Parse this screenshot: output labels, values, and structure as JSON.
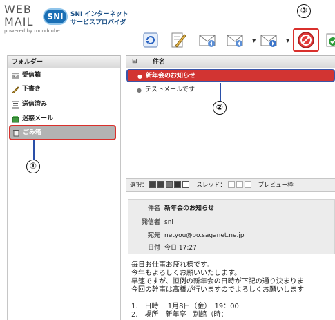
{
  "logo": {
    "web": "WEB",
    "mail": "MAIL",
    "powered": "powered by roundcube",
    "badge": "SNI",
    "provider_line1": "SNI インターネット",
    "provider_line2": "サービスプロバイダ"
  },
  "toolbar": {
    "buttons": [
      "refresh-icon",
      "compose-icon",
      "reply-icon",
      "reply-all-icon",
      "forward-icon",
      "delete-icon",
      "mark-icon"
    ],
    "highlight_color": "#d9302c"
  },
  "callouts": {
    "one": "①",
    "two": "②",
    "three": "③"
  },
  "folders": {
    "title": "フォルダー",
    "items": [
      {
        "label": "受信箱",
        "icon": "inbox-icon"
      },
      {
        "label": "下書き",
        "icon": "pencil-icon"
      },
      {
        "label": "送信済み",
        "icon": "sent-icon"
      },
      {
        "label": "迷惑メール",
        "icon": "junk-icon"
      },
      {
        "label": "ごみ箱",
        "icon": "trash-icon"
      }
    ]
  },
  "message_list": {
    "column_subject": "件名",
    "rows": [
      {
        "subject": "新年会のお知らせ",
        "selected": true
      },
      {
        "subject": "テストメールです",
        "selected": false
      }
    ]
  },
  "select_bar": {
    "select_label": "選択：",
    "thread_label": "スレッド：",
    "preview_label": "プレビュー枠"
  },
  "preview": {
    "subject_key": "件名",
    "subject": "新年会のお知らせ",
    "from_key": "発信者",
    "from": "sni",
    "to_key": "宛先",
    "to": "netyou@po.saganet.ne.jp",
    "date_key": "日付",
    "date": "今日 17:27"
  },
  "body": {
    "line1": "毎日お仕事お疲れ様です。",
    "line2": "今年もよろしくお願いいたします。",
    "line3": "早速ですが、恒例の新年会の日時が下記の通り決まりま",
    "line4": "今回の幹事は高橋が行いますのでよろしくお願いします",
    "line5": "",
    "line6": "1.　日時　 1月8日（金）　19：00",
    "line7": "2.　場所　新年亭　別館（時："
  }
}
